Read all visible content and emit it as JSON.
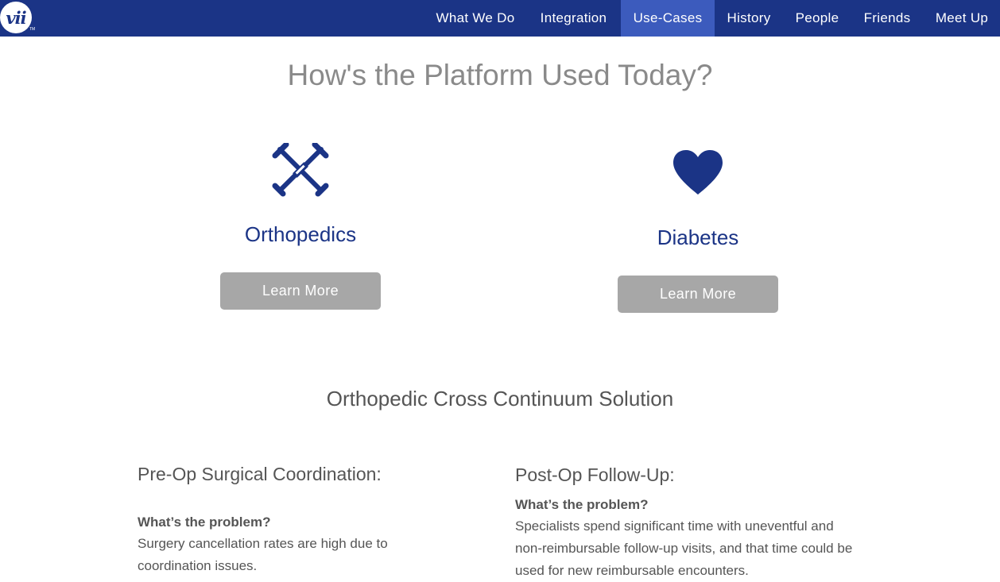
{
  "nav": {
    "logo_text": "vii",
    "logo_tm": "TM",
    "items": [
      {
        "label": "What We Do"
      },
      {
        "label": "Integration"
      },
      {
        "label": "Use-Cases",
        "active": true
      },
      {
        "label": "History"
      },
      {
        "label": "People"
      },
      {
        "label": "Friends"
      },
      {
        "label": "Meet Up"
      }
    ]
  },
  "main": {
    "title": "How's the Platform Used Today?",
    "cards": [
      {
        "icon": "crutches-icon",
        "title": "Orthopedics",
        "button": "Learn More"
      },
      {
        "icon": "heart-icon",
        "title": "Diabetes",
        "button": "Learn More"
      }
    ]
  },
  "solution": {
    "title": "Orthopedic Cross Continuum Solution",
    "columns": [
      {
        "heading": "Pre-Op Surgical Coordination:",
        "problem_label": "What’s the problem?",
        "problem_text": "Surgery cancellation rates are high due to coordination issues."
      },
      {
        "heading": "Post-Op Follow-Up:",
        "problem_label": "What’s the problem?",
        "problem_text": "Specialists spend significant time with uneventful and non-reimbursable follow-up visits, and that time could be used for new reimbursable encounters."
      }
    ]
  },
  "colors": {
    "nav_bg": "#1b3486",
    "nav_active": "#3c5bbd",
    "brand_blue": "#1b3486",
    "button_gray": "#a7a7a7",
    "title_gray": "#8a8a8a",
    "text_gray": "#555555"
  }
}
